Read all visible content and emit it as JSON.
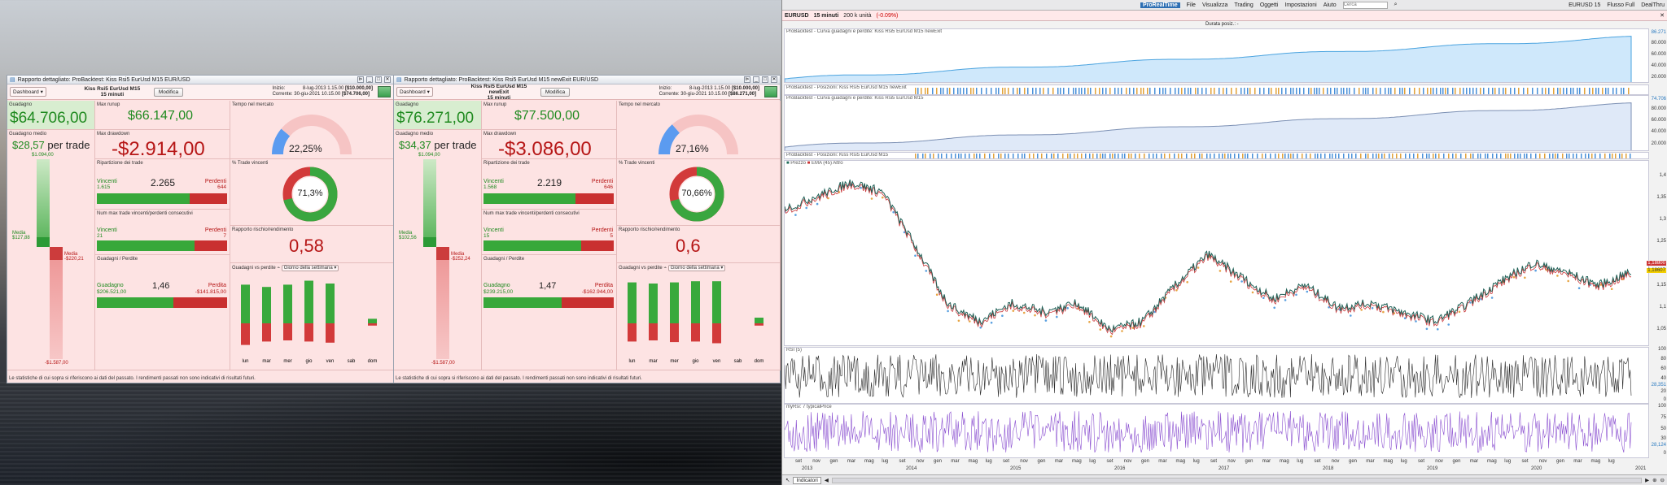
{
  "report1": {
    "window_title": "Rapporto dettagliato: ProBacktest: Kiss Rsi5 EurUsd M15  EUR/USD",
    "dashboard": "Dashboard",
    "strategy": "Kiss Rsi5 EurUsd M15",
    "timeframe": "15 minuti",
    "modify": "Modifica",
    "start_label": "Inizio:",
    "start": "8-lug-2013 1.15.00",
    "start_cap": "[$10.000,00]",
    "current_label": "Corrente:",
    "current": "30-giu-2021 10.15.00",
    "current_cap": "[$74.706,00]",
    "gain_label": "Guadagno",
    "gain": "$64.706,00",
    "avg_label": "Guadagno medio",
    "avg": "$28,57",
    "per_trade": "per trade",
    "runup_label": "Max runup",
    "runup": "$66.147,00",
    "drawdown_label": "Max drawdown",
    "drawdown": "-$2.914,00",
    "market_time_label": "Tempo nel mercato",
    "market_time": "22,25%",
    "dist_label": "Ripartizione dei trade",
    "winners": "Vincenti",
    "losers": "Perdenti",
    "total": "2.265",
    "win_n": "1.615",
    "lose_n": "644",
    "win_pct_label": "% Trade vincenti",
    "win_pct": "71,3%",
    "consec_label": "Num max trade vincenti/perdenti consecutivi",
    "consec_win": "21",
    "consec_lose": "7",
    "risk_label": "Rapporto rischio/rendimento",
    "risk": "0,58",
    "gl_label": "Guadagni / Perdite",
    "gain_word": "Guadagno",
    "loss_word": "Perdita",
    "gl_ratio": "1,46",
    "gain_tot": "$206.521,00",
    "loss_tot": "-$141.815,00",
    "week_label": "Guadagni vs perdite",
    "week_dd": "Giorno della settimana",
    "vb_top": "$1.094,00",
    "vb_media_g": "Media",
    "vb_media_g_val": "$127,88",
    "vb_media_p": "Media",
    "vb_media_p_val": "-$220,21",
    "vb_bottom": "-$1.587,00",
    "days": [
      "lun",
      "mar",
      "mer",
      "gio",
      "ven",
      "sab",
      "dom"
    ],
    "day_gain": [
      0.68,
      0.64,
      0.68,
      0.75,
      0.7,
      0,
      0.08
    ],
    "day_loss": [
      0.38,
      0.32,
      0.3,
      0.32,
      0.34,
      0,
      0.04
    ],
    "footer": "Le statistiche di cui sopra si riferiscono ai dati del passato. I rendimenti passati non sono indicativi di risultati futuri.",
    "win_fraction": 0.713,
    "market_fraction": 0.2225,
    "dist_fraction": 0.713,
    "consec_fraction": 0.75,
    "gl_fraction": 0.59
  },
  "report2": {
    "window_title": "Rapporto dettagliato: ProBacktest: Kiss Rsi5 EurUsd M15 newExit  EUR/USD",
    "dashboard": "Dashboard",
    "strategy": "Kiss Rsi5 EurUsd M15 newExit",
    "timeframe": "15 minuti",
    "modify": "Modifica",
    "start_label": "Inizio:",
    "start": "8-lug-2013 1.15.00",
    "start_cap": "[$10.000,00]",
    "current_label": "Corrente:",
    "current": "30-giu-2021 10.15.00",
    "current_cap": "[$86.271,00]",
    "gain_label": "Guadagno",
    "gain": "$76.271,00",
    "avg_label": "Guadagno medio",
    "avg": "$34,37",
    "per_trade": "per trade",
    "runup_label": "Max runup",
    "runup": "$77.500,00",
    "drawdown_label": "Max drawdown",
    "drawdown": "-$3.086,00",
    "market_time_label": "Tempo nel mercato",
    "market_time": "27,16%",
    "dist_label": "Ripartizione dei trade",
    "winners": "Vincenti",
    "losers": "Perdenti",
    "total": "2.219",
    "win_n": "1.568",
    "lose_n": "646",
    "win_pct_label": "% Trade vincenti",
    "win_pct": "70,66%",
    "consec_label": "Num max trade vincenti/perdenti consecutivi",
    "consec_win": "15",
    "consec_lose": "5",
    "risk_label": "Rapporto rischio/rendimento",
    "risk": "0,6",
    "gl_label": "Guadagni / Perdite",
    "gain_word": "Guadagno",
    "loss_word": "Perdita",
    "gl_ratio": "1,47",
    "gain_tot": "$239.215,00",
    "loss_tot": "-$162.944,00",
    "week_label": "Guadagni vs perdite",
    "week_dd": "Giorno della settimana",
    "vb_top": "$1.094,00",
    "vb_media_g": "Media",
    "vb_media_g_val": "$102,56",
    "vb_media_p": "Media",
    "vb_media_p_val": "-$252,24",
    "vb_bottom": "-$1.587,00",
    "days": [
      "lun",
      "mar",
      "mer",
      "gio",
      "ven",
      "sab",
      "dom"
    ],
    "day_gain": [
      0.72,
      0.7,
      0.72,
      0.74,
      0.74,
      0,
      0.1
    ],
    "day_loss": [
      0.32,
      0.3,
      0.33,
      0.32,
      0.35,
      0,
      0.04
    ],
    "footer": "Le statistiche di cui sopra si riferiscono ai dati del passato. I rendimenti passati non sono indicativi di risultati futuri.",
    "win_fraction": 0.7066,
    "market_fraction": 0.2716,
    "dist_fraction": 0.706,
    "consec_fraction": 0.75,
    "gl_fraction": 0.6
  },
  "platform": {
    "menus": [
      "File",
      "Visualizza",
      "Trading",
      "Oggetti",
      "Impostazioni",
      "Aiuto"
    ],
    "search_placeholder": "Cerca",
    "right_items": [
      "EURUSD 15",
      "Flusso Full",
      "DealThru"
    ],
    "symbol": "EURUSD",
    "timeframe": "15 minuti",
    "units": "200 k unità",
    "change": "(-0.09%)",
    "duration": "Durata posiz.: -",
    "pane1_title": "ProBacktest - Curva guadagni e perdite: Kiss Rsi5 EurUsd M15 newExit",
    "pane1_y": [
      "80.000",
      "60.000",
      "40.000",
      "20.000"
    ],
    "pane1_last": "86.271",
    "pane2_title": "ProBacktest - Posizioni: Kiss Rsi5 EurUsd M15 newExit",
    "pane3_title": "ProBacktest - Curva guadagni e perdite: Kiss Rsi5 EurUsd M15",
    "pane3_y": [
      "80.000",
      "60.000",
      "40.000",
      "20.000"
    ],
    "pane3_last": "74.706",
    "pane4_title": "ProBacktest - Posizioni: Kiss Rsi5 EurUsd M15",
    "price_title": "Prezzo",
    "ema_title": "EMA (45) Altro",
    "price_y": [
      "1,4",
      "1,35",
      "1,3",
      "1,25",
      "1,2",
      "1,15",
      "1,1",
      "1,05"
    ],
    "price_last": "1,18607",
    "ema_last": "1,18800",
    "rsi_title": "RSI (5)",
    "rsi_y": [
      "100",
      "80",
      "60",
      "40",
      "20",
      "0"
    ],
    "rsi_last": "28,351",
    "myrsi_title": "myRsi: 7 typicalPrice",
    "myrsi_y": [
      "100",
      "75",
      "50",
      "30",
      "0"
    ],
    "myrsi_last": "28,124",
    "months": [
      "set",
      "nov",
      "gen",
      "mar",
      "mag",
      "lug",
      "set",
      "nov",
      "gen",
      "mar",
      "mag",
      "lug",
      "set",
      "nov",
      "gen",
      "mar",
      "mag",
      "lug",
      "set",
      "nov",
      "gen",
      "mar",
      "mag",
      "lug",
      "set",
      "nov",
      "gen",
      "mar",
      "mag",
      "lug",
      "set",
      "nov",
      "gen",
      "mar",
      "mag",
      "lug",
      "set",
      "nov",
      "gen",
      "mar",
      "mag",
      "lug",
      "set",
      "nov",
      "gen",
      "mar",
      "mag",
      "lug"
    ],
    "years": [
      "2013",
      "2014",
      "2015",
      "2016",
      "2017",
      "2018",
      "2019",
      "2020",
      "2021"
    ],
    "indicators_btn": "Indicatori",
    "eurusd_label": "EURUSD"
  }
}
